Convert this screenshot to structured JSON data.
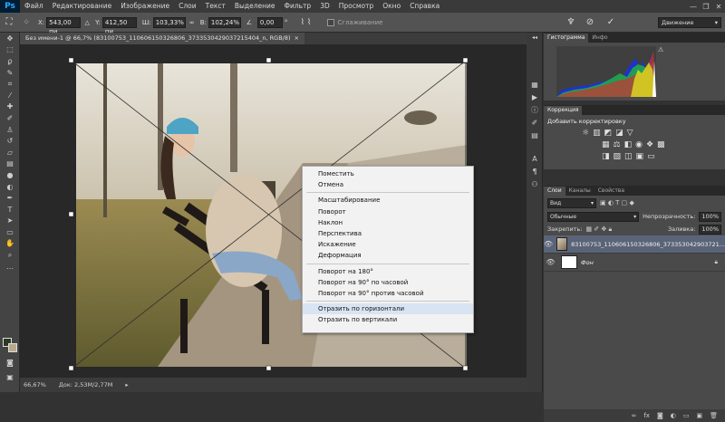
{
  "app": {
    "logo": "Ps",
    "workspace": "Движение"
  },
  "menu": [
    "Файл",
    "Редактирование",
    "Изображение",
    "Слои",
    "Текст",
    "Выделение",
    "Фильтр",
    "3D",
    "Просмотр",
    "Окно",
    "Справка"
  ],
  "window_controls": {
    "minimize": "—",
    "restore": "❐",
    "close": "✕"
  },
  "options": {
    "x_label": "X:",
    "x_value": "543,00 пи",
    "y_label": "Y:",
    "y_value": "412,50 пи",
    "w_label": "Ш:",
    "w_value": "103,33%",
    "h_label": "В:",
    "h_value": "102,24%",
    "angle_value": "0,00",
    "angle_unit": "°",
    "antialias": "Сглаживание"
  },
  "document": {
    "tab_title": "Без имени-1 @ 66,7% (83100753_110606150326806_3733530429037215404_n, RGB/8)",
    "close": "×"
  },
  "status": {
    "zoom": "66,67%",
    "doc": "Док: 2,53M/2,77M"
  },
  "context_menu": {
    "group1": [
      "Поместить",
      "Отмена"
    ],
    "group2": [
      "Масштабирование",
      "Поворот",
      "Наклон",
      "Перспектива",
      "Искажение",
      "Деформация"
    ],
    "group3": [
      "Поворот на 180°",
      "Поворот на 90° по часовой",
      "Поворот на 90° против часовой"
    ],
    "group4": [
      "Отразить по горизонтали",
      "Отразить по вертикали"
    ]
  },
  "histogram": {
    "tabs": [
      "Гистограмма",
      "Инфо"
    ]
  },
  "adjustments": {
    "tabs": [
      "Коррекция"
    ],
    "title": "Добавить корректировку"
  },
  "layers": {
    "tabs": [
      "Слои",
      "Каналы",
      "Свойства"
    ],
    "filter": "Вид",
    "blend": "Обычные",
    "opacity_label": "Непрозрачность:",
    "opacity": "100%",
    "lock_label": "Закрепить:",
    "fill_label": "Заливка:",
    "fill": "100%",
    "items": [
      {
        "name": "83100753_110606150326806_373353042903721..."
      },
      {
        "name": "Фон"
      }
    ]
  },
  "colors": {
    "accent": "#31a8ff",
    "menu_highlight": "#d8e4f2"
  }
}
